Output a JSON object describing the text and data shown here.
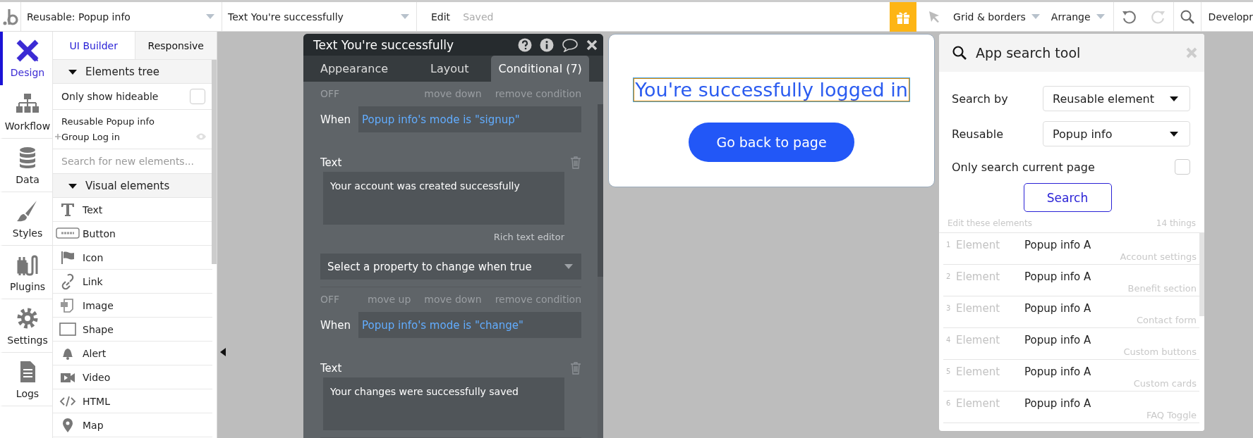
{
  "topbar": {
    "page_selector": "Reusable: Popup info",
    "element_selector": "Text You're successfully",
    "edit": "Edit",
    "saved": "Saved",
    "grid": "Grid & borders",
    "arrange": "Arrange",
    "history": [
      {
        "kind": "undo",
        "disabled": false
      },
      {
        "kind": "redo",
        "disabled": true
      }
    ],
    "environment": "Developr"
  },
  "sidebar": {
    "items": [
      {
        "label": "Design",
        "kind": "design",
        "selected": true
      },
      {
        "label": "Workflow",
        "kind": "workflow",
        "selected": false
      },
      {
        "label": "Data",
        "kind": "data",
        "selected": false
      },
      {
        "label": "Styles",
        "kind": "styles",
        "selected": false
      },
      {
        "label": "Plugins",
        "kind": "plugins",
        "selected": false
      },
      {
        "label": "Settings",
        "kind": "settings",
        "selected": false
      },
      {
        "label": "Logs",
        "kind": "logs",
        "selected": false
      }
    ]
  },
  "panel": {
    "tabs": [
      {
        "label": "UI Builder",
        "selected": true
      },
      {
        "label": "Responsive",
        "selected": false
      }
    ],
    "elements_tree": {
      "title": "Elements tree",
      "expanded": true,
      "only_hideable": {
        "label": "Only show hideable",
        "checked": false
      },
      "items": [
        {
          "label": "Reusable Popup info",
          "children": [
            {
              "label": "Group Log in",
              "expanded": false
            }
          ]
        }
      ]
    },
    "search": {
      "placeholder": "Search for new elements..."
    },
    "visual_elements": {
      "title": "Visual elements",
      "expanded": true,
      "items": [
        {
          "label": "Text",
          "kind": "text"
        },
        {
          "label": "Button",
          "kind": "button"
        },
        {
          "label": "Icon",
          "kind": "icon"
        },
        {
          "label": "Link",
          "kind": "link"
        },
        {
          "label": "Image",
          "kind": "image"
        },
        {
          "label": "Shape",
          "kind": "shape"
        },
        {
          "label": "Alert",
          "kind": "alert"
        },
        {
          "label": "Video",
          "kind": "video"
        },
        {
          "label": "HTML",
          "kind": "html"
        },
        {
          "label": "Map",
          "kind": "map"
        }
      ]
    }
  },
  "editor": {
    "title": "Text You're successfully",
    "tabs": [
      {
        "label": "Appearance",
        "selected": false
      },
      {
        "label": "Layout",
        "selected": false
      },
      {
        "label": "Conditional (7)",
        "selected": true
      }
    ],
    "conditions": [
      {
        "status": "OFF",
        "actions": [
          "move down",
          "remove condition"
        ],
        "when_label": "When",
        "expression": "Popup info's mode is \"signup\"",
        "property_label": "Text",
        "value": "Your account was created successfully",
        "rich_text": "Rich text editor",
        "select_placeholder": "Select a property to change when true"
      },
      {
        "status": "OFF",
        "actions": [
          "move up",
          "move down",
          "remove condition"
        ],
        "when_label": "When",
        "expression": "Popup info's mode is \"change\"",
        "property_label": "Text",
        "value": "Your changes were successfully saved"
      }
    ]
  },
  "canvas": {
    "heading": {
      "text": "You're successfully logged in",
      "selected": true
    },
    "button": "Go back to page"
  },
  "search_tool": {
    "title": "App search tool",
    "fields": [
      {
        "label": "Search by",
        "value": "Reusable element"
      },
      {
        "label": "Reusable",
        "value": "Popup info"
      }
    ],
    "only_current": {
      "label": "Only search current page",
      "checked": false
    },
    "button": "Search",
    "results_label": "Edit these elements",
    "count": "14 things",
    "results": [
      {
        "index": "1",
        "type": "Element",
        "name": "Popup info A",
        "page": "Account settings"
      },
      {
        "index": "2",
        "type": "Element",
        "name": "Popup info A",
        "page": "Benefit section"
      },
      {
        "index": "3",
        "type": "Element",
        "name": "Popup info A",
        "page": "Contact form"
      },
      {
        "index": "4",
        "type": "Element",
        "name": "Popup info A",
        "page": "Custom buttons"
      },
      {
        "index": "5",
        "type": "Element",
        "name": "Popup info A",
        "page": "Custom cards"
      },
      {
        "index": "6",
        "type": "Element",
        "name": "Popup info A",
        "page": "FAQ Toggle"
      }
    ]
  }
}
